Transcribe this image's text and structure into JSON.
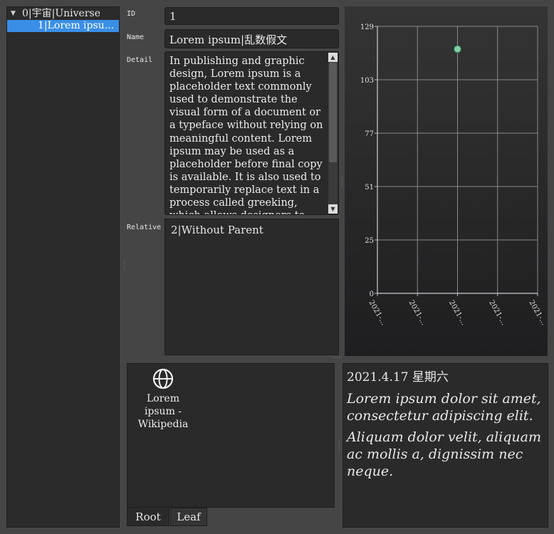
{
  "tree": {
    "root": {
      "arrow": "▼",
      "label": "0|宇宙|Universe"
    },
    "child": {
      "label": "1|Lorem ipsu..."
    }
  },
  "form": {
    "id_label": "ID",
    "id_value": "1",
    "name_label": "Name",
    "name_value": "Lorem ipsum|乱数假文",
    "detail_label": "Detail",
    "detail_value": "In publishing and graphic design, Lorem ipsum is a placeholder text commonly used to demonstrate the visual form of a document or a typeface without relying on meaningful content. Lorem ipsum may be used as a placeholder before final copy is available. It is also used to temporarily replace text in a process called greeking, which allows designers to",
    "relative_label": "Relative",
    "relative_value": "2|Without Parent"
  },
  "chart_data": {
    "type": "scatter",
    "y_ticks": [
      "0",
      "25",
      "51",
      "77",
      "103",
      "129"
    ],
    "x_ticks": [
      "2021-...",
      "2021-...",
      "2021-...",
      "2021-...",
      "2021-..."
    ],
    "ylim": [
      0,
      129
    ],
    "points": [
      {
        "x_index": 2,
        "y": 118
      }
    ],
    "point_color": "#7fd0a4",
    "grid": true
  },
  "icon_view": {
    "item": {
      "icon": "globe-icon",
      "caption_lines": [
        "Lorem",
        "ipsum -",
        "Wikipedia"
      ]
    },
    "tabs": [
      "Root",
      "Leaf"
    ]
  },
  "text_view": {
    "date": "2021.4.17 星期六",
    "paragraphs": [
      "Lorem ipsum dolor sit amet, consectetur adipiscing elit.",
      "Aliquam dolor velit, aliquam ac mollis a, dignissim nec neque."
    ]
  }
}
